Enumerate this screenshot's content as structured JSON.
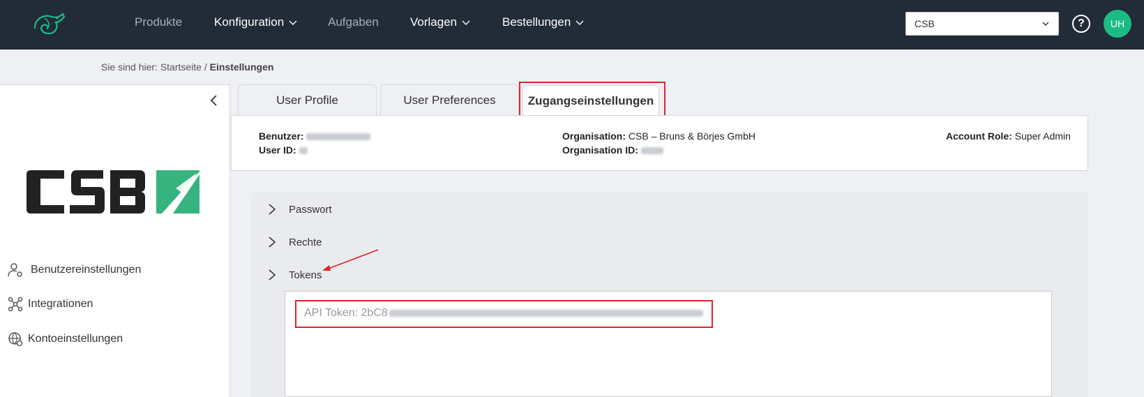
{
  "nav": {
    "items": [
      {
        "label": "Produkte",
        "dropdown": false,
        "muted": true
      },
      {
        "label": "Konfiguration",
        "dropdown": true,
        "muted": false
      },
      {
        "label": "Aufgaben",
        "dropdown": false,
        "muted": true
      },
      {
        "label": "Vorlagen",
        "dropdown": true,
        "muted": false
      },
      {
        "label": "Bestellungen",
        "dropdown": true,
        "muted": false
      }
    ],
    "org_select_value": "CSB",
    "help_label": "?",
    "avatar_initials": "UH"
  },
  "breadcrumb": {
    "prefix": "Sie sind hier:",
    "home": "Startseite",
    "separator": "/",
    "current": "Einstellungen"
  },
  "sidebar": {
    "logo_text": "CSB",
    "items": [
      {
        "label": "Benutzereinstellungen",
        "icon": "user-gear-icon"
      },
      {
        "label": "Integrationen",
        "icon": "network-icon"
      },
      {
        "label": "Kontoeinstellungen",
        "icon": "globe-gear-icon"
      }
    ]
  },
  "tabs": [
    {
      "label": "User Profile",
      "active": false
    },
    {
      "label": "User Preferences",
      "active": false
    },
    {
      "label": "Zugangseinstellungen",
      "active": true
    }
  ],
  "info": {
    "user_label": "Benutzer:",
    "user_id_label": "User ID:",
    "org_label": "Organisation:",
    "org_value": "CSB – Bruns & Börjes GmbH",
    "org_id_label": "Organisation ID:",
    "role_label": "Account Role:",
    "role_value": "Super Admin"
  },
  "accordion": {
    "items": [
      "Passwort",
      "Rechte",
      "Tokens"
    ]
  },
  "token": {
    "label": "API Token: 2bC8"
  },
  "colors": {
    "topbar": "#222b38",
    "accent": "#1bbb85",
    "highlight": "#e0232b"
  }
}
